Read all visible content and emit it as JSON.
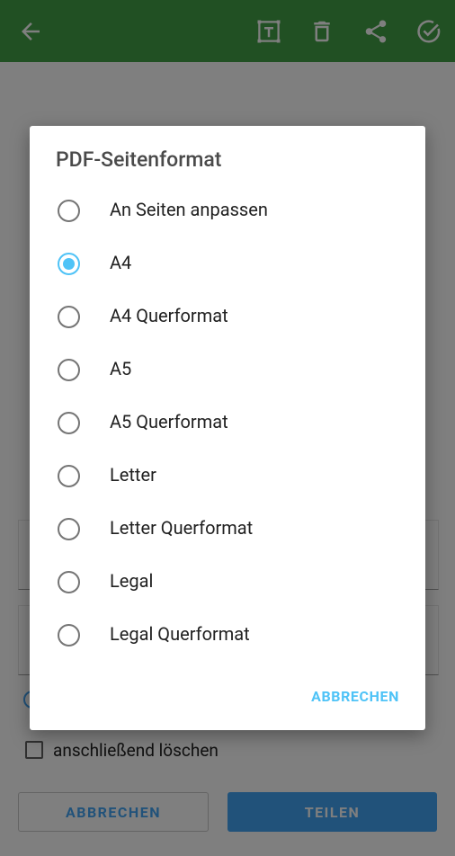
{
  "colors": {
    "appbar": "#43a047",
    "accent": "#4fc3f7",
    "primary_button": "#42a5f5"
  },
  "appbar": {
    "icons": [
      "back-arrow-icon",
      "text-box-icon",
      "delete-icon",
      "share-icon",
      "check-circle-icon"
    ]
  },
  "background": {
    "checkbox_label": "anschließend löschen",
    "cancel_button": "ABBRECHEN",
    "share_button": "TEILEN"
  },
  "dialog": {
    "title": "PDF-Seitenformat",
    "selected_option": "A4",
    "options": [
      {
        "label": "An Seiten anpassen",
        "selected": false
      },
      {
        "label": "A4",
        "selected": true
      },
      {
        "label": "A4 Querformat",
        "selected": false
      },
      {
        "label": "A5",
        "selected": false
      },
      {
        "label": "A5 Querformat",
        "selected": false
      },
      {
        "label": "Letter",
        "selected": false
      },
      {
        "label": "Letter Querformat",
        "selected": false
      },
      {
        "label": "Legal",
        "selected": false
      },
      {
        "label": "Legal Querformat",
        "selected": false
      }
    ],
    "cancel_label": "ABBRECHEN"
  }
}
